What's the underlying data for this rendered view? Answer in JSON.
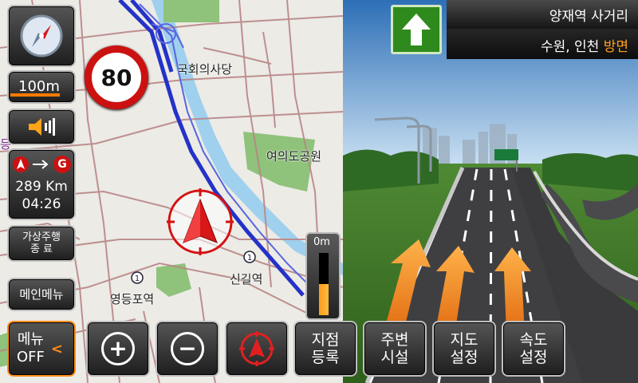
{
  "left_controls": {
    "compass": "compass-icon",
    "scale_label": "100m",
    "volume": "speaker-icon",
    "route_summary": {
      "from_icon": "current-position-icon",
      "to_icon": "G",
      "distance": "289 Km",
      "eta": "04:26"
    },
    "sim_drive_end": {
      "line1": "가상주행",
      "line2": "종 료"
    },
    "main_menu": "메인메뉴"
  },
  "speed_limit": {
    "value": "80",
    "color": "#cc1111"
  },
  "map_labels": {
    "national_assembly": "국회의사당",
    "yeouido_park": "여의도공원",
    "singil_station": "신길역",
    "yeongdeungpo_station": "영등포역",
    "edge_fragment": "등"
  },
  "zoom_gauge": {
    "label": "0m",
    "fill_fraction": 0.5
  },
  "guidance": {
    "intersection_name": "양재역 사거리",
    "direction_text": "수원, 인천",
    "direction_suffix": "방면",
    "arrow": "straight-arrow-icon",
    "arrow_color": "#2e8a1c",
    "suffix_color": "#ffa020"
  },
  "toolbar": {
    "menu_off": {
      "line1": "메뉴",
      "line2": "OFF",
      "chevron": "<"
    },
    "zoom_in": "+",
    "zoom_out": "−",
    "current_location": "current-position-icon",
    "register_point": {
      "line1": "지점",
      "line2": "등록"
    },
    "nearby_facilities": {
      "line1": "주변",
      "line2": "시설"
    },
    "map_settings": {
      "line1": "지도",
      "line2": "설정"
    },
    "speed_settings": {
      "line1": "속도",
      "line2": "설정"
    }
  },
  "colors": {
    "accent_orange": "#ff8c1a",
    "route_blue": "#2432c8",
    "road_red": "#b06a6a"
  }
}
